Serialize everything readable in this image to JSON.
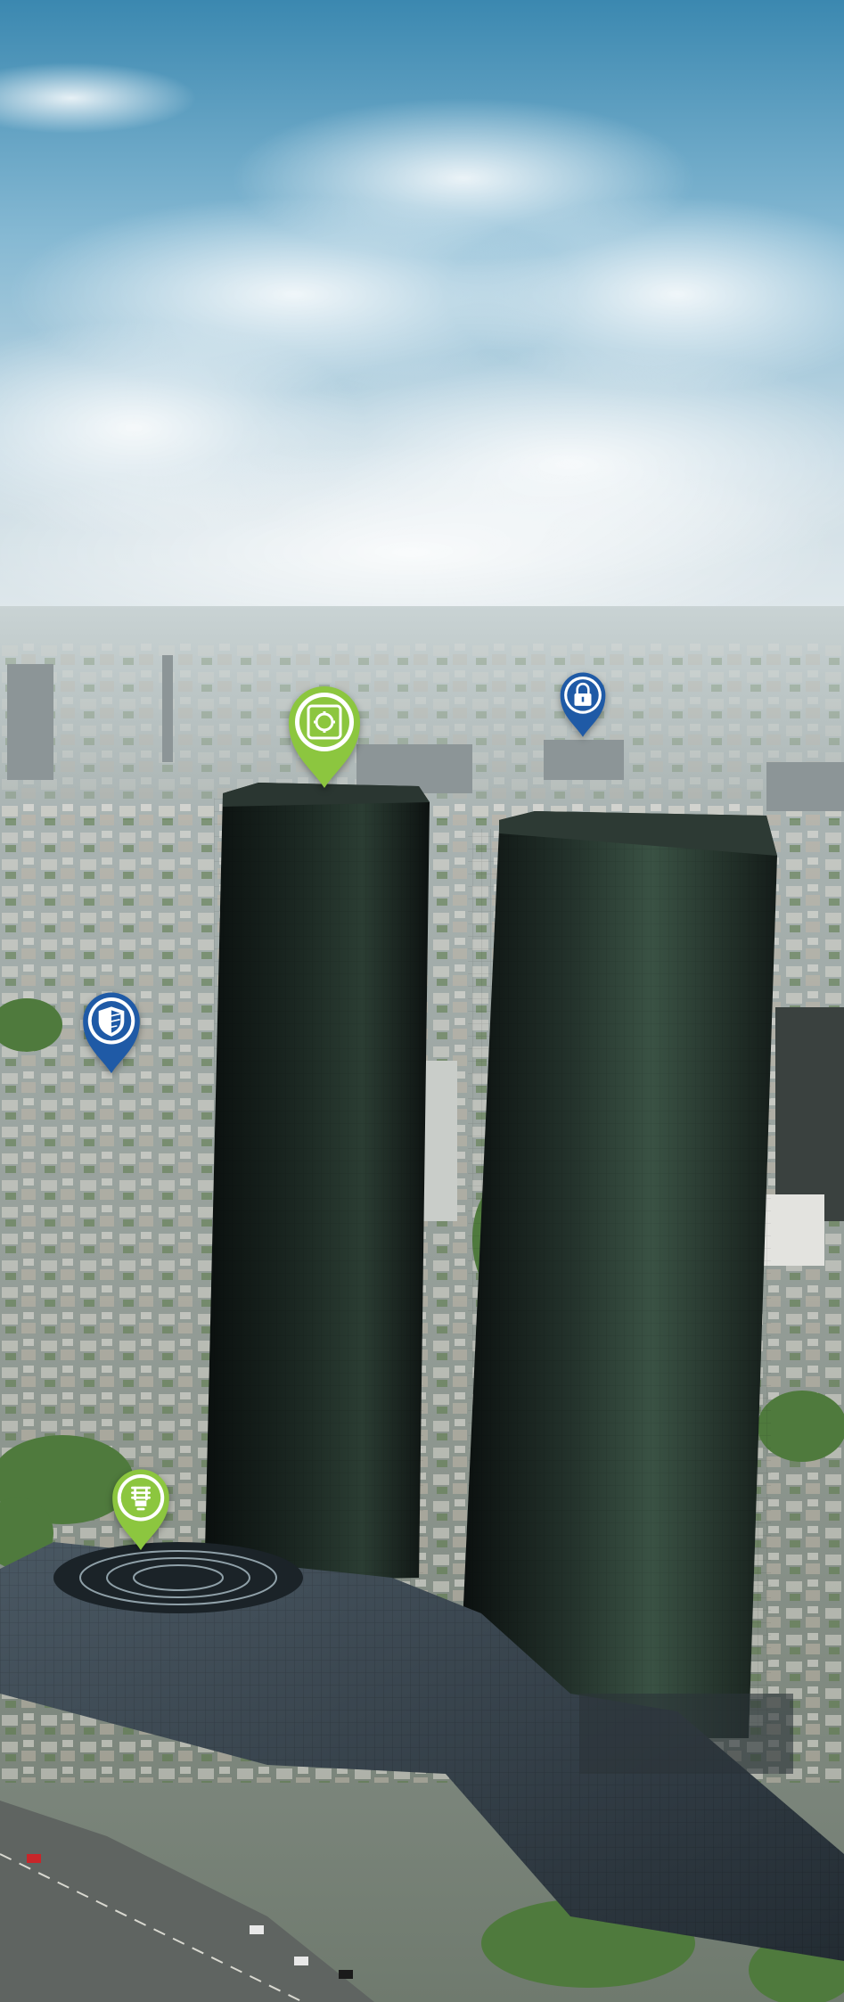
{
  "scene": {
    "sky_top_color": "#3f8fb7",
    "sky_mid_color": "#8fc0d8",
    "haze_color": "#dfe8ec",
    "city_color": "#9aa6a6",
    "tower_color": "#0e1413",
    "tower_reflection_color": "#2f4a3c",
    "roof_glass_color": "#3a4a55",
    "road_color": "#6a6e6c",
    "tree_color": "#4e7a3e"
  },
  "markers": [
    {
      "name": "safe-vault-marker",
      "icon": "safe-vault-icon",
      "color": "#8cc63f"
    },
    {
      "name": "lock-marker",
      "icon": "padlock-icon",
      "color": "#1f5aa6"
    },
    {
      "name": "shield-marker",
      "icon": "shield-icon",
      "color": "#1f5aa6"
    },
    {
      "name": "lightbulb-marker",
      "icon": "energy-saving-bulb-icon",
      "color": "#8cc63f"
    }
  ]
}
